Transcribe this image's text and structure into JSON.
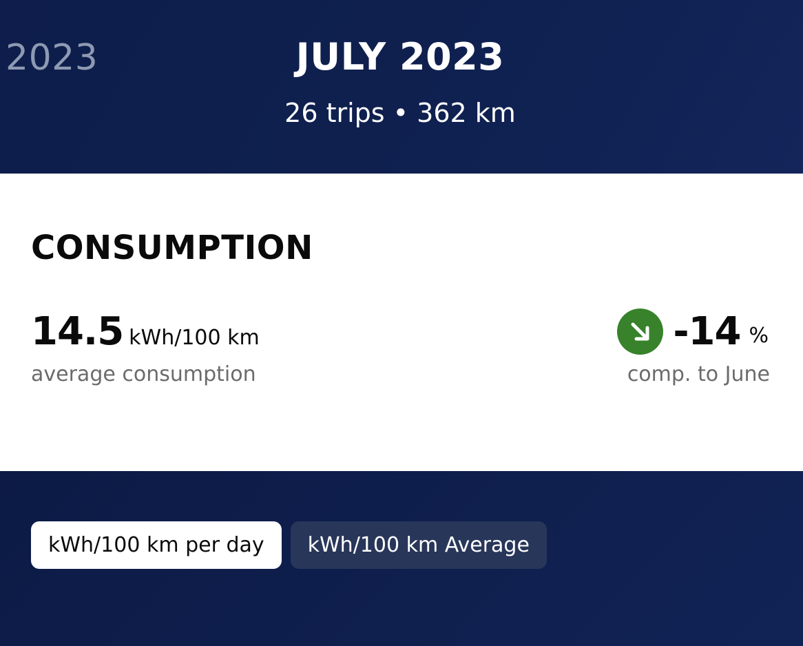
{
  "header": {
    "prev_year": "2023",
    "month_title": "JULY 2023",
    "trip_summary": "26 trips • 362 km"
  },
  "consumption": {
    "title": "CONSUMPTION",
    "average": {
      "value": "14.5",
      "unit": "kWh/100 km",
      "label": "average consumption"
    },
    "comparison": {
      "trend_icon": "arrow-down-right-icon",
      "trend_color": "#37822b",
      "value": "-14",
      "unit": "%",
      "label": "comp. to June"
    }
  },
  "toggles": [
    {
      "label": "kWh/100 km per day",
      "active": true
    },
    {
      "label": "kWh/100 km Average",
      "active": false
    }
  ]
}
